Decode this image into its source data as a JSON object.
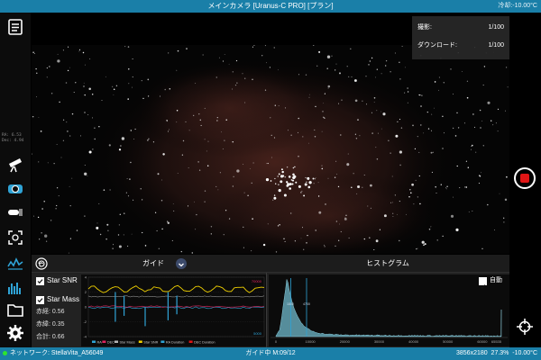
{
  "window": {
    "title": "メインカメラ [Uranus-C PRO] [プラン]",
    "cooling_status": "冷却:-10.00°C"
  },
  "sidebar": {
    "radec": {
      "ra": "RA: 6.53",
      "dec": "Dec: 4.94"
    },
    "buttons": [
      {
        "name": "checklist-icon"
      },
      {
        "name": "telescope-icon"
      },
      {
        "name": "camera-icon"
      },
      {
        "name": "focuser-icon"
      },
      {
        "name": "focus-frame-icon"
      },
      {
        "name": "guide-graph-icon"
      },
      {
        "name": "histogram-icon"
      },
      {
        "name": "folder-icon"
      },
      {
        "name": "gear-icon"
      }
    ]
  },
  "capture_panel": {
    "shots_label": "撮影:",
    "shots_value": "1/100",
    "download_label": "ダウンロード:",
    "download_value": "1/100"
  },
  "guide_panel": {
    "title": "ガイド",
    "star_snr_label": "Star SNR",
    "star_mass_label": "Star Mass",
    "ra_label": "赤経: 0.56",
    "dec_label": "赤緯: 0.35",
    "total_label": "合計: 0.66",
    "y_ticks": [
      "4",
      "2",
      "0",
      "-2",
      "-4"
    ],
    "top_right_label": "70000",
    "bottom_right_label": "5000",
    "legend": [
      {
        "label": "RA",
        "color": "#2fa3d6"
      },
      {
        "label": "DEC",
        "color": "#e0245e"
      },
      {
        "label": "Star Mass",
        "color": "#b5b5b5"
      },
      {
        "label": "Star SNR",
        "color": "#f0d000"
      },
      {
        "label": "RA Duration",
        "color": "#2fa3d6"
      },
      {
        "label": "DEC Duration",
        "color": "#e01515"
      }
    ]
  },
  "histogram_panel": {
    "title": "ヒストグラム",
    "auto_label": "自動",
    "x_ticks": [
      "0",
      "10000",
      "20000",
      "30000",
      "40000",
      "50000",
      "60000",
      "65535"
    ],
    "black_marker": "1800",
    "white_marker": "4700"
  },
  "status_bar": {
    "network": "ネットワーク: StellaVita_A56049",
    "guide_status": "ガイド中 M:09/12",
    "resolution": "3856x2180",
    "zoom": "27.3%",
    "temperature": "-10.00°C"
  },
  "colors": {
    "accent": "#1a7fa8",
    "record": "#e01515",
    "ra_line": "#2fa3d6",
    "dec_line": "#e0245e",
    "snr_line": "#f0d000",
    "histogram": "#7fd4ea"
  }
}
